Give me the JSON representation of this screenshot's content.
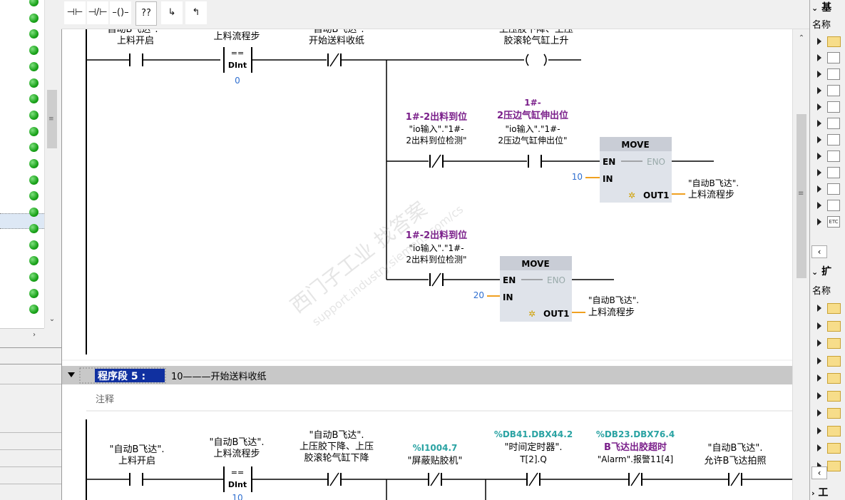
{
  "toolbar": {
    "buttons": [
      "⊣⊢",
      "⊣/⊢",
      "–()–",
      "??",
      "↳",
      "↰"
    ]
  },
  "network5": {
    "title": "程序段 5 :",
    "comment_title": "10———开始送料收纸",
    "comment_placeholder": "注释"
  },
  "net4": {
    "rung1": {
      "c1_label_top": "\"自动B飞达\".",
      "c1_label": "上料开启",
      "cmp_label": "上料流程步",
      "cmp_op": "==",
      "cmp_type": "DInt",
      "cmp_value": "0",
      "c2_label_top": "\"自动B飞达\".",
      "c2_label": "开始送料收纸",
      "coil_label_top": "上压胶下降、上压",
      "coil_label": "胶滚轮气缸上升"
    },
    "rung2": {
      "c3_symbol": "1#-2出料到位",
      "c3_addr1": "\"io输入\".\"1#-",
      "c3_addr2": "2出料到位检测\"",
      "c4_symbol_top": "1#-",
      "c4_symbol": "2压边气缸伸出位",
      "c4_addr1": "\"io输入\".\"1#-",
      "c4_addr2": "2压边气缸伸出位\"",
      "move_title": "MOVE",
      "en": "EN",
      "eno": "ENO",
      "in_label": "IN",
      "in_value": "10",
      "out_label": "OUT1",
      "out_var1": "\"自动B飞达\".",
      "out_var2": "上料流程步"
    },
    "rung3": {
      "c5_symbol": "1#-2出料到位",
      "c5_addr1": "\"io输入\".\"1#-",
      "c5_addr2": "2出料到位检测\"",
      "move_title": "MOVE",
      "en": "EN",
      "eno": "ENO",
      "in_label": "IN",
      "in_value": "20",
      "out_label": "OUT1",
      "out_var1": "\"自动B飞达\".",
      "out_var2": "上料流程步"
    }
  },
  "net5": {
    "c1_l1": "\"自动B飞达\".",
    "c1_l2": "上料开启",
    "cmp_l1": "\"自动B飞达\".",
    "cmp_l2": "上料流程步",
    "cmp_op": "==",
    "cmp_type": "DInt",
    "cmp_value": "10",
    "c2_l1": "\"自动B飞达\".",
    "c2_l2": "上压胶下降、上压",
    "c2_l3": "胶滚轮气缸下降",
    "c3_addr": "%I1004.7",
    "c3_name": "\"屏蔽贴胶机\"",
    "c4_addr": "%DB41.DBX44.2",
    "c4_l1": "\"时间定时器\".",
    "c4_l2": "T[2].Q",
    "c5_addr": "%DB23.DBX76.4",
    "c5_sym": "B飞达出胶超时",
    "c5_l2": "\"Alarm\".报警11[4]",
    "c6_l1": "\"自动B飞达\".",
    "c6_l2": "允许B飞达拍照"
  },
  "watermark": {
    "line1": "西门子工业  找答案",
    "line2": "support.industry.siemens.com/cs"
  },
  "right_panel": {
    "section1_title": "基",
    "section1_col": "名称",
    "section2_title": "扩",
    "section2_col": "名称",
    "section3_title": "工",
    "instr_icons": [
      "folder",
      "-|I",
      "timer",
      "+1",
      "cmp",
      "±",
      "~",
      "conv",
      "prog",
      "word",
      "shift",
      "ETC"
    ]
  },
  "colors": {
    "symbol_purple": "#7a1f8a",
    "address_teal": "#2aa3a3",
    "value_blue": "#2f6fd0",
    "wire_orange": "#f0a020",
    "network_header_bg": "#c8c8c8"
  }
}
